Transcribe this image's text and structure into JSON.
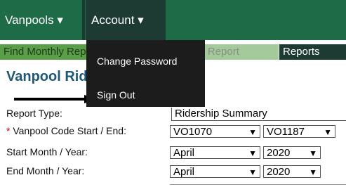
{
  "nav": {
    "vanpools": "Vanpools ▾",
    "account": "Account ▾"
  },
  "subnav": {
    "find_monthly": "Find Monthly Report",
    "new_monthly": "New Monthly Report",
    "reports": "Reports"
  },
  "page_title": "Vanpool Ridership Reports",
  "account_menu": {
    "items": [
      "Change Password",
      "Sign Out"
    ]
  },
  "form": {
    "report_type": {
      "label": "Report Type:",
      "value": "Ridership Summary"
    },
    "vanpool_code": {
      "required_marker": "*",
      "label": "Vanpool Code Start / End:",
      "start": "VO1070",
      "end": "VO1187"
    },
    "start_month": {
      "label": "Start Month / Year:",
      "month": "April",
      "year": "2020"
    },
    "end_month": {
      "label": "End Month / Year:",
      "month": "April",
      "year": "2020"
    }
  },
  "colors": {
    "nav_green": "#1e6b47",
    "nav_dark": "#1d3a33",
    "tab_green": "#5a9e48",
    "title_blue": "#1e5a78",
    "dropdown_bg": "#1c1c1c"
  }
}
